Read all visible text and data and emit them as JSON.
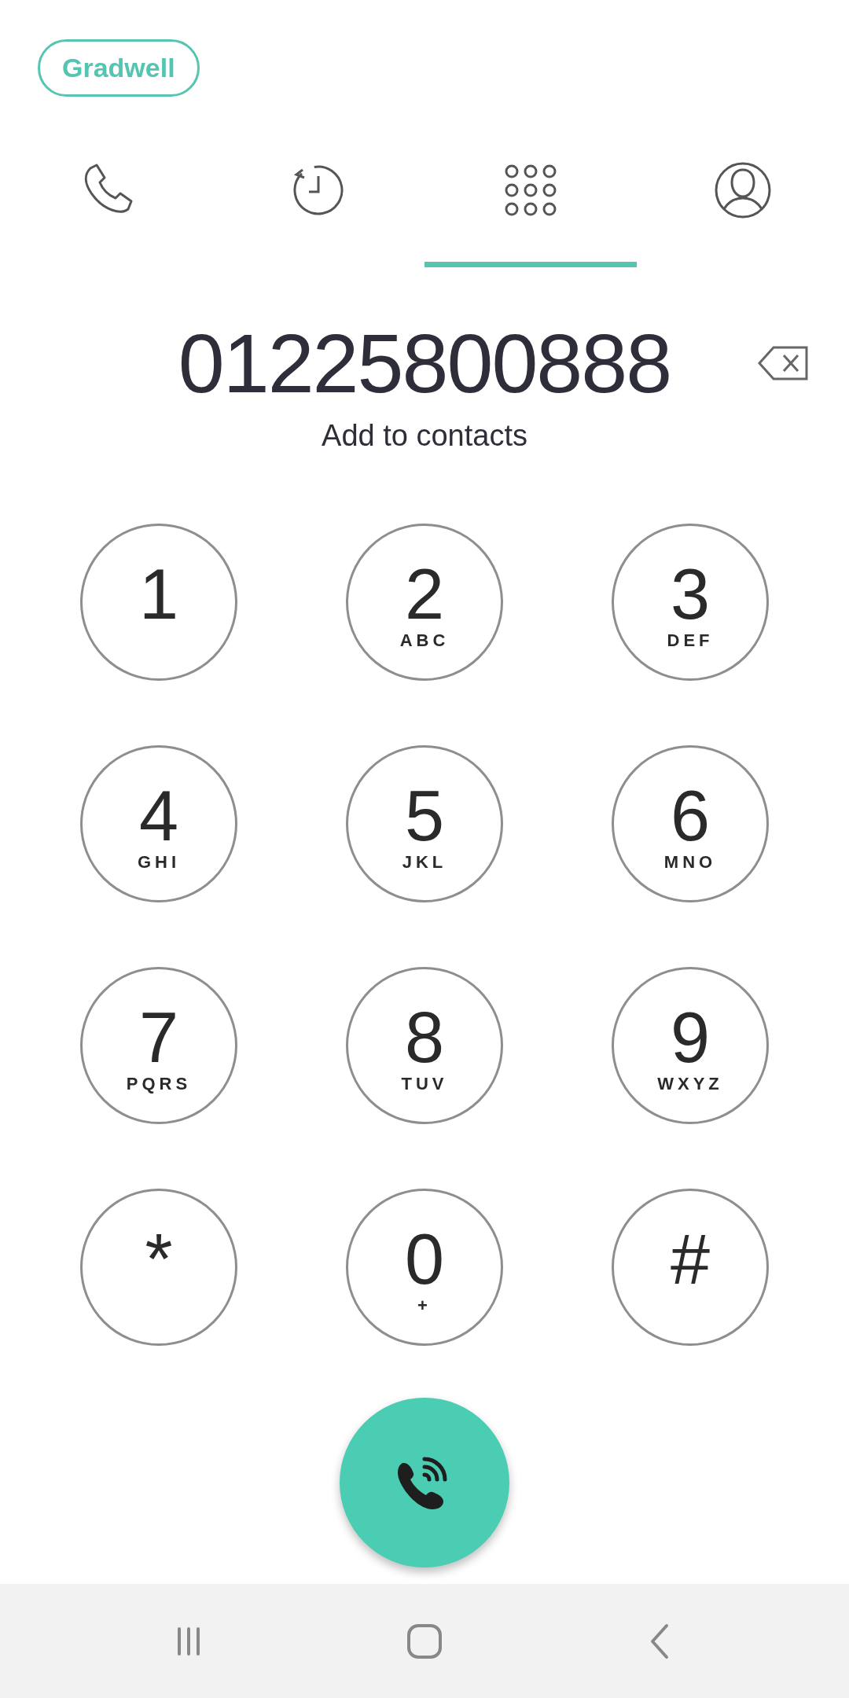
{
  "brand": {
    "label": "Gradwell"
  },
  "tabs": [
    {
      "kind": "phone",
      "selected": false
    },
    {
      "kind": "history",
      "selected": false
    },
    {
      "kind": "keypad",
      "selected": true
    },
    {
      "kind": "contact",
      "selected": false
    }
  ],
  "dialed_number": "01225800888",
  "add_to_contacts": "Add to contacts",
  "keys": [
    {
      "digit": "1"
    },
    {
      "digit": "2",
      "letters": "ABC"
    },
    {
      "digit": "3",
      "letters": "DEF"
    },
    {
      "digit": "4",
      "letters": "GHI"
    },
    {
      "digit": "5",
      "letters": "JKL"
    },
    {
      "digit": "6",
      "letters": "MNO"
    },
    {
      "digit": "7",
      "letters": "PQRS"
    },
    {
      "digit": "8",
      "letters": "TUV"
    },
    {
      "digit": "9",
      "letters": "WXYZ"
    },
    {
      "digit": "*"
    },
    {
      "digit": "0",
      "letters": "+"
    },
    {
      "digit": "#"
    }
  ],
  "nav_bar": [
    {
      "kind": "recents"
    },
    {
      "kind": "home"
    },
    {
      "kind": "back"
    }
  ]
}
